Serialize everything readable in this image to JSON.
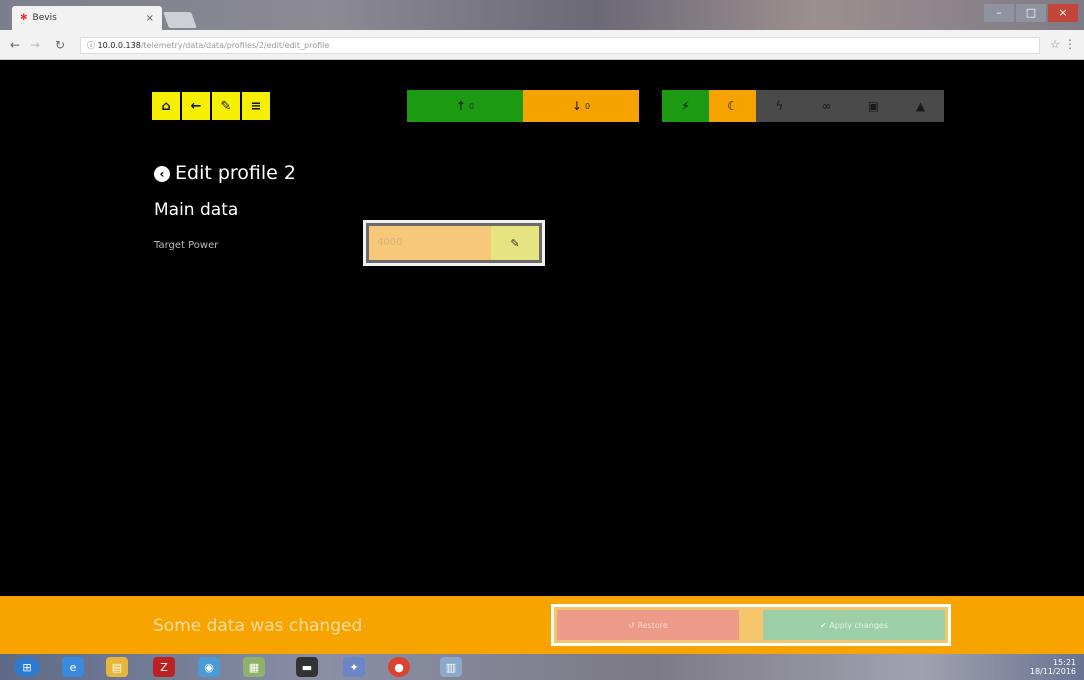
{
  "browser": {
    "tab_title": "Bevis",
    "tab_close": "×",
    "url_host": "10.0.0.138",
    "url_path": "/telemetry/data/data/profiles/2/edit/edit_profile",
    "window_controls": [
      "–",
      "□",
      "×"
    ]
  },
  "toolbar": {
    "home_icon": "home-icon",
    "back_icon": "arrow-left-icon",
    "settings_icon": "wrench-icon",
    "menu_icon": "menu-icon"
  },
  "stats": {
    "upload_count": "0",
    "download_count": "0"
  },
  "modes": [
    {
      "name": "plug-icon",
      "color": "#1c9a12"
    },
    {
      "name": "moon-icon",
      "color": "#f6a300"
    },
    {
      "name": "bolt-icon",
      "color": "#4a4a4a"
    },
    {
      "name": "link-icon",
      "color": "#4a4a4a"
    },
    {
      "name": "lock-icon",
      "color": "#4a4a4a"
    },
    {
      "name": "warning-icon",
      "color": "#4a4a4a"
    }
  ],
  "page": {
    "title": "Edit profile 2",
    "section": "Main data",
    "field_label": "Target Power",
    "field_value": "4000"
  },
  "notification": {
    "text": "Some data was changed",
    "restore_label": "Restore",
    "apply_label": "Apply changes"
  },
  "taskbar": {
    "clock_time": "15:21",
    "clock_date": "18/11/2016"
  },
  "colors": {
    "accent_yellow": "#f7ef00",
    "accent_green": "#1c9a12",
    "accent_orange": "#f6a300",
    "notification_bg": "#f7a400"
  }
}
